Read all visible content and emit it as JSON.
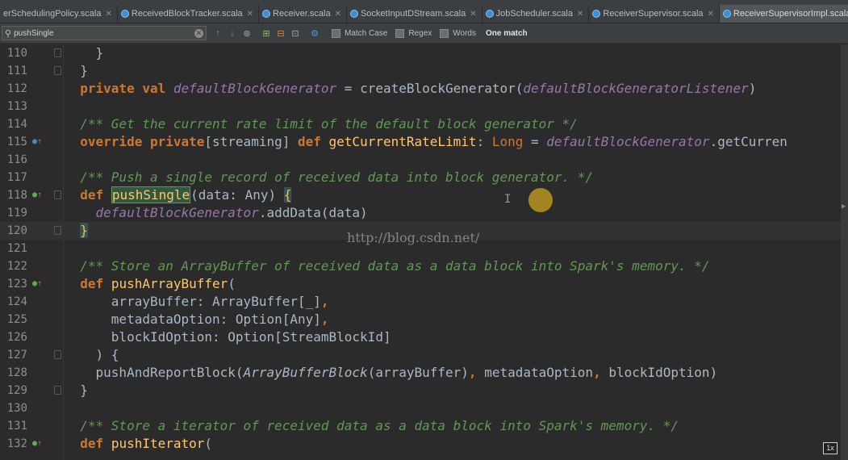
{
  "tabs": [
    {
      "label": "erSchedulingPolicy.scala",
      "active": false
    },
    {
      "label": "ReceivedBlockTracker.scala",
      "active": false
    },
    {
      "label": "Receiver.scala",
      "active": false
    },
    {
      "label": "SocketInputDStream.scala",
      "active": false
    },
    {
      "label": "JobScheduler.scala",
      "active": false
    },
    {
      "label": "ReceiverSupervisor.scala",
      "active": false
    },
    {
      "label": "ReceiverSupervisorImpl.scala",
      "active": true
    }
  ],
  "tab_overflow_label": "»≡",
  "search": {
    "query": "pushSingle",
    "match_case_label": "Match Case",
    "regex_label": "Regex",
    "words_label": "Words",
    "result_label": "One match"
  },
  "editor": {
    "line_numbers": [
      "110",
      "111",
      "112",
      "113",
      "114",
      "115",
      "116",
      "117",
      "118",
      "119",
      "120",
      "121",
      "122",
      "123",
      "124",
      "125",
      "126",
      "127",
      "128",
      "129",
      "130",
      "131",
      "132"
    ]
  },
  "watermark": "http://blog.csdn.net/",
  "zoom_label": "1x",
  "colors": {
    "keyword": "#cc7832",
    "comment": "#629755",
    "field": "#9876aa",
    "text": "#a9b7c6",
    "background": "#2b2b2b"
  }
}
